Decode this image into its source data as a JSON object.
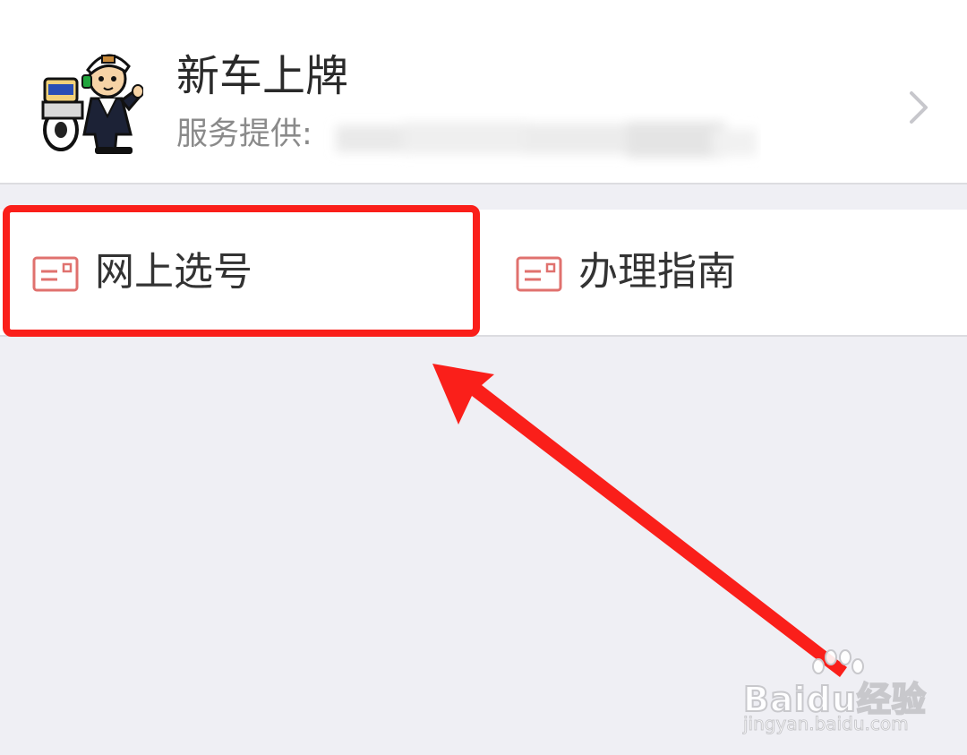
{
  "header": {
    "title": "新车上牌",
    "provider_label": "服务提供:",
    "avatar_icon": "traffic-police-cartoon-icon",
    "chevron_icon": "chevron-right-icon"
  },
  "actions": [
    {
      "label": "网上选号",
      "icon": "card-icon"
    },
    {
      "label": "办理指南",
      "icon": "card-icon"
    }
  ],
  "annotation": {
    "highlight_color": "#fa1f1a"
  },
  "watermark": {
    "brand": "Baidu经验",
    "url": "jingyan.baidu.com"
  },
  "colors": {
    "background": "#efeff4",
    "icon_accent": "#e0716e",
    "chevron": "#c7c7cc"
  }
}
